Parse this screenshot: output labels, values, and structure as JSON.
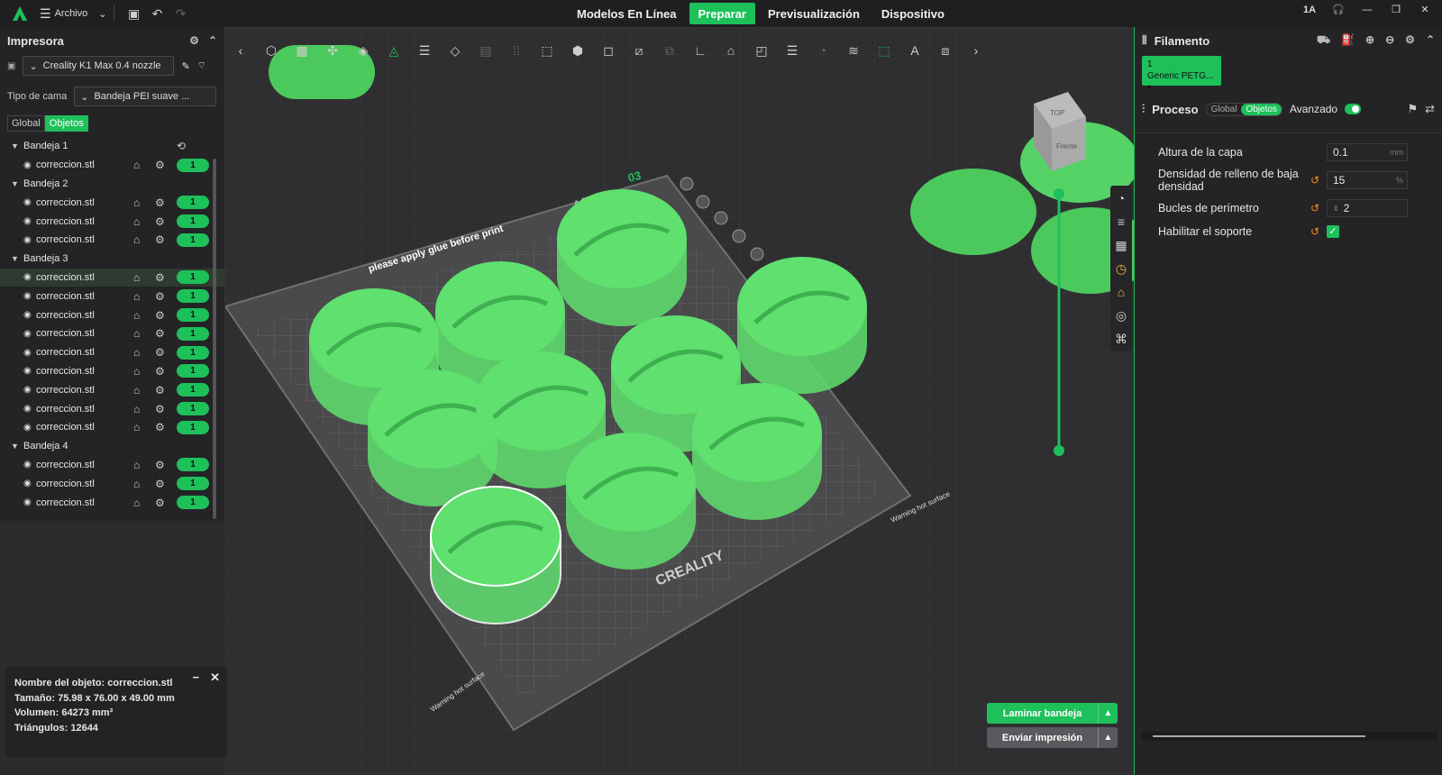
{
  "topbar": {
    "file_menu_label": "Archivo",
    "tabs": [
      {
        "label": "Modelos En Línea",
        "active": false
      },
      {
        "label": "Preparar",
        "active": true
      },
      {
        "label": "Previsualización",
        "active": false
      },
      {
        "label": "Dispositivo",
        "active": false
      }
    ],
    "language_label": "1A"
  },
  "printer_panel": {
    "title": "Impresora",
    "printer_name": "Creality K1 Max 0.4 nozzle",
    "bed_type_label": "Tipo de cama",
    "bed_type_value": "Bandeja PEI suave ...",
    "scope_tabs": [
      "Global",
      "Objetos"
    ],
    "active_scope": "Objetos"
  },
  "object_tree": [
    {
      "type": "plate",
      "label": "Bandeja 1"
    },
    {
      "type": "object",
      "label": "correccion.stl",
      "count": "1"
    },
    {
      "type": "plate",
      "label": "Bandeja 2"
    },
    {
      "type": "object",
      "label": "correccion.stl",
      "count": "1"
    },
    {
      "type": "object",
      "label": "correccion.stl",
      "count": "1"
    },
    {
      "type": "object",
      "label": "correccion.stl",
      "count": "1"
    },
    {
      "type": "plate",
      "label": "Bandeja 3"
    },
    {
      "type": "object",
      "label": "correccion.stl",
      "count": "1",
      "selected": true
    },
    {
      "type": "object",
      "label": "correccion.stl",
      "count": "1"
    },
    {
      "type": "object",
      "label": "correccion.stl",
      "count": "1"
    },
    {
      "type": "object",
      "label": "correccion.stl",
      "count": "1"
    },
    {
      "type": "object",
      "label": "correccion.stl",
      "count": "1"
    },
    {
      "type": "object",
      "label": "correccion.stl",
      "count": "1"
    },
    {
      "type": "object",
      "label": "correccion.stl",
      "count": "1"
    },
    {
      "type": "object",
      "label": "correccion.stl",
      "count": "1"
    },
    {
      "type": "object",
      "label": "correccion.stl",
      "count": "1"
    },
    {
      "type": "plate",
      "label": "Bandeja 4"
    },
    {
      "type": "object",
      "label": "correccion.stl",
      "count": "1"
    },
    {
      "type": "object",
      "label": "correccion.stl",
      "count": "1"
    },
    {
      "type": "object",
      "label": "correccion.stl",
      "count": "1"
    }
  ],
  "object_info": {
    "name": "Nombre del objeto: correccion.stl",
    "size": "Tamaño: 75.98 x 76.00 x 49.00 mm",
    "volume": "Volumen: 64273 mm³",
    "triangles": "Triángulos: 12644"
  },
  "bed": {
    "plate_number": "03",
    "plate_label": "A Plate",
    "glue_note": "please apply glue before print",
    "brand": "CREALITY",
    "warning": "Warning hot surface",
    "nav_cube_top": "TOP",
    "nav_cube_front": "Frente",
    "model_color": "#5fe06f"
  },
  "actions": {
    "slice_label": "Laminar bandeja",
    "send_label": "Enviar impresión"
  },
  "filament_panel": {
    "title": "Filamento",
    "chip_index": "1",
    "chip_name": "Generic PETG..."
  },
  "process_panel": {
    "title": "Proceso",
    "scope_tabs": [
      "Global",
      "Objetos"
    ],
    "advanced_label": "Avanzado",
    "params": [
      {
        "label": "Altura de la capa",
        "value": "0.1",
        "unit": "mm",
        "modified": false
      },
      {
        "label": "Densidad de relleno de baja densidad",
        "value": "15",
        "unit": "%",
        "modified": true
      },
      {
        "label": "Bucles de perímetro",
        "value": "2",
        "unit": "",
        "modified": true
      },
      {
        "label": "Habilitar el soporte",
        "checked": true,
        "modified": true
      }
    ]
  },
  "colors": {
    "accent": "#1ec05a",
    "panel_bg": "#242427",
    "viewport_bg": "#2f2f31"
  }
}
